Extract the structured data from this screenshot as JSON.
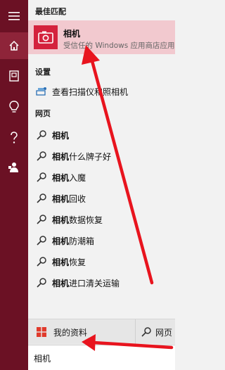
{
  "rail": {
    "items": [
      {
        "icon": "hamburger-icon"
      },
      {
        "icon": "home-icon",
        "active": true
      },
      {
        "icon": "notebook-icon"
      },
      {
        "icon": "lightbulb-icon"
      },
      {
        "icon": "help-icon"
      },
      {
        "icon": "feedback-icon"
      }
    ]
  },
  "sections": {
    "best_match": "最佳匹配",
    "settings": "设置",
    "web": "网页"
  },
  "best_match": {
    "title": "相机",
    "subtitle": "受信任的 Windows 应用商店应用"
  },
  "settings_items": [
    {
      "label": "查看扫描仪和照相机"
    }
  ],
  "web_items": [
    {
      "bold": "相机",
      "rest": ""
    },
    {
      "bold": "相机",
      "rest": "什么牌子好"
    },
    {
      "bold": "相机",
      "rest": "入魔"
    },
    {
      "bold": "相机",
      "rest": "回收"
    },
    {
      "bold": "相机",
      "rest": "数据恢复"
    },
    {
      "bold": "相机",
      "rest": "防潮箱"
    },
    {
      "bold": "相机",
      "rest": "恢复"
    },
    {
      "bold": "相机",
      "rest": "进口清关运输"
    }
  ],
  "bottom": {
    "my_info": "我的资料",
    "web": "网页"
  },
  "search": {
    "value": "相机"
  },
  "colors": {
    "rail": "#6b1124",
    "highlight": "#f2c9cf",
    "tile": "#d4223d",
    "annotation_arrow": "#e8141e"
  }
}
